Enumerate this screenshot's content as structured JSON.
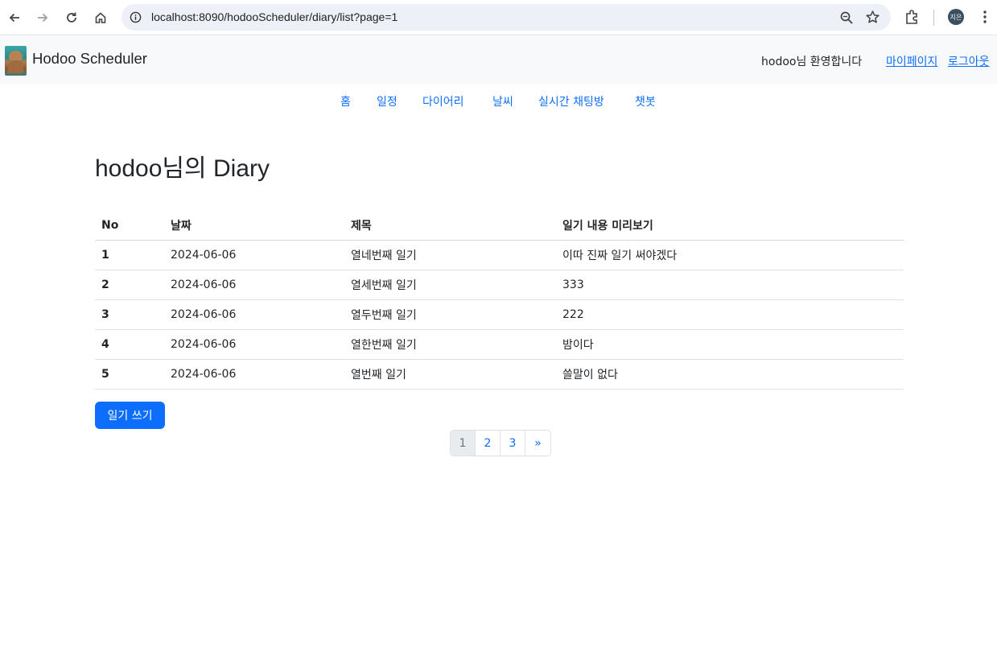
{
  "browser": {
    "url": "localhost:8090/hodooScheduler/diary/list?page=1",
    "profile_initials": "지은"
  },
  "navbar": {
    "brand": "Hodoo Scheduler",
    "welcome": "hodoo님 환영합니다",
    "mypage": "마이페이지",
    "logout": "로그아웃"
  },
  "menu": {
    "items": [
      "홈",
      "일정",
      "다이어리",
      "날씨",
      "실시간 채팅방",
      "챗봇"
    ]
  },
  "main": {
    "title": "hodoo님의 Diary",
    "table": {
      "headers": [
        "No",
        "날짜",
        "제목",
        "일기 내용 미리보기"
      ],
      "rows": [
        [
          "1",
          "2024-06-06",
          "열네번째 일기",
          "이따 진짜 일기 써야겠다"
        ],
        [
          "2",
          "2024-06-06",
          "열세번째 일기",
          "333"
        ],
        [
          "3",
          "2024-06-06",
          "열두번째 일기",
          "222"
        ],
        [
          "4",
          "2024-06-06",
          "열한번째 일기",
          "밤이다"
        ],
        [
          "5",
          "2024-06-06",
          "열번째 일기",
          "쓸말이 없다"
        ]
      ]
    },
    "write_button": "일기 쓰기",
    "pagination": {
      "pages": [
        "1",
        "2",
        "3",
        "»"
      ],
      "active": "1"
    }
  },
  "colors": {
    "primary": "#0d6efd",
    "navbar_bg": "#f8f9fa",
    "text": "#212529"
  }
}
